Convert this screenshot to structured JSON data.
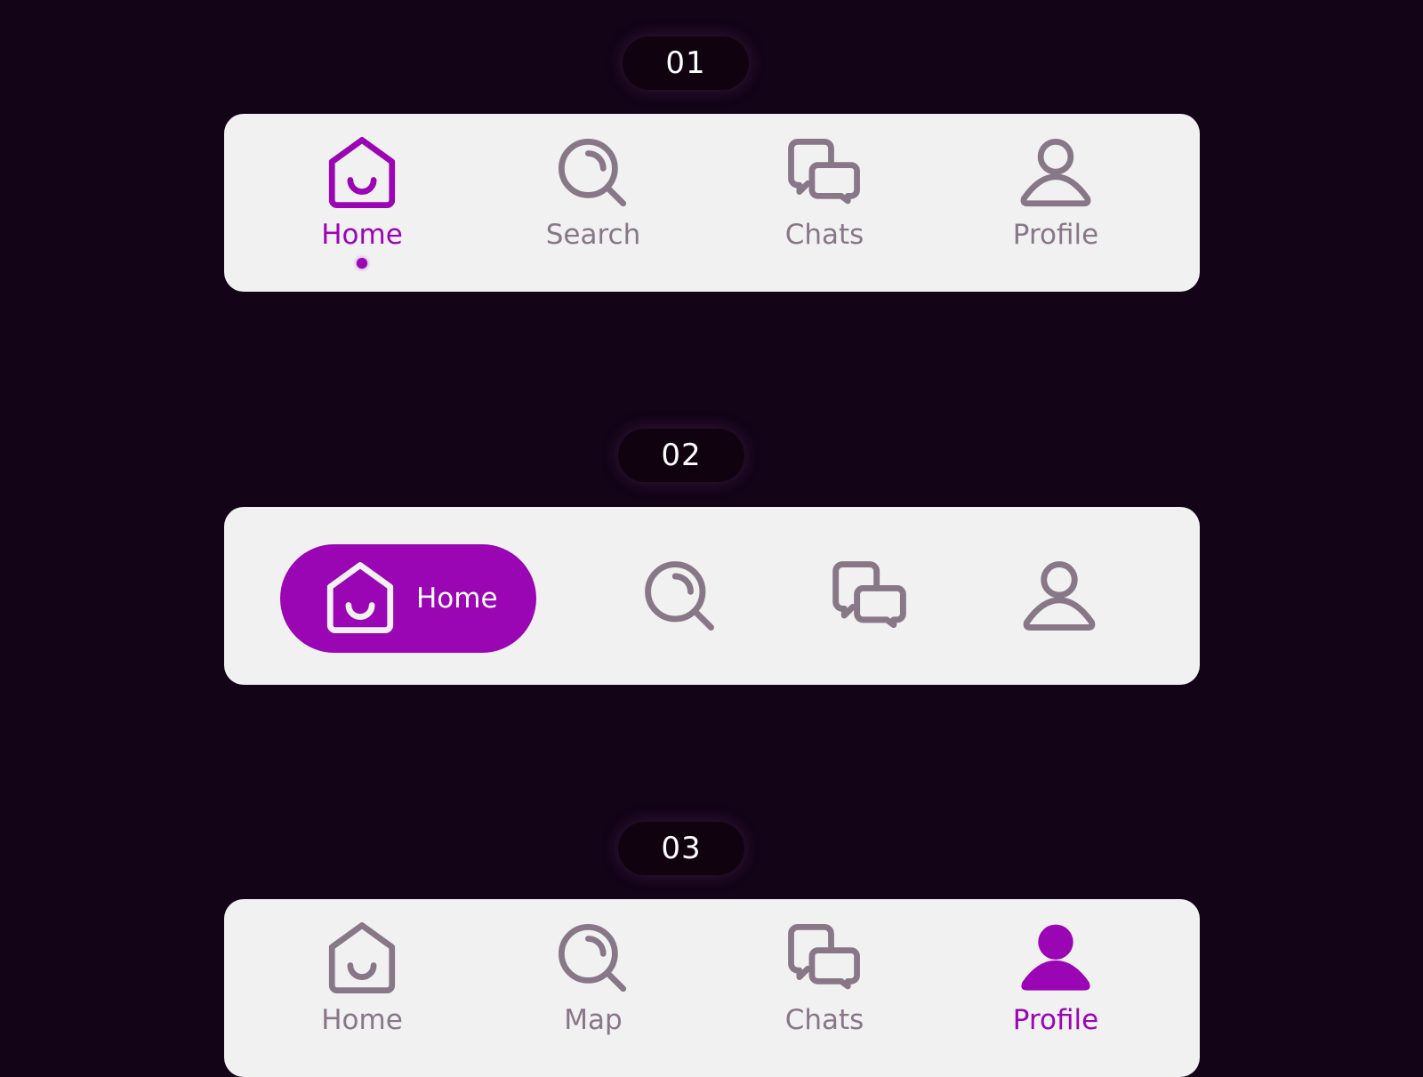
{
  "colors": {
    "background": "#130418",
    "bar": "#f1f1f1",
    "accent": "#9a05b4",
    "inactive": "#877787",
    "badge": "#10020f"
  },
  "variants": [
    {
      "badge": "01",
      "items": [
        {
          "label": "Home",
          "icon": "home-icon",
          "active": true
        },
        {
          "label": "Search",
          "icon": "search-icon",
          "active": false
        },
        {
          "label": "Chats",
          "icon": "chats-icon",
          "active": false
        },
        {
          "label": "Profile",
          "icon": "profile-icon",
          "active": false
        }
      ]
    },
    {
      "badge": "02",
      "items": [
        {
          "label": "Home",
          "icon": "home-icon",
          "active": true
        },
        {
          "label": "",
          "icon": "search-icon",
          "active": false
        },
        {
          "label": "",
          "icon": "chats-icon",
          "active": false
        },
        {
          "label": "",
          "icon": "profile-icon",
          "active": false
        }
      ]
    },
    {
      "badge": "03",
      "items": [
        {
          "label": "Home",
          "icon": "home-icon",
          "active": false
        },
        {
          "label": "Map",
          "icon": "search-icon",
          "active": false
        },
        {
          "label": "Chats",
          "icon": "chats-icon",
          "active": false
        },
        {
          "label": "Profile",
          "icon": "profile-icon",
          "active": true
        }
      ]
    }
  ]
}
